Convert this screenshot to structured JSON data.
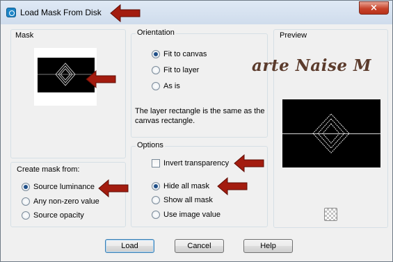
{
  "window": {
    "title": "Load Mask From Disk",
    "close_symbol": "×"
  },
  "mask": {
    "group_label": "Mask"
  },
  "create_from": {
    "group_label": "Create mask from:",
    "options": [
      {
        "label": "Source luminance",
        "checked": true
      },
      {
        "label": "Any non-zero value",
        "checked": false
      },
      {
        "label": "Source opacity",
        "checked": false
      }
    ]
  },
  "orientation": {
    "group_label": "Orientation",
    "options": [
      {
        "label": "Fit to canvas",
        "checked": true
      },
      {
        "label": "Fit to layer",
        "checked": false
      },
      {
        "label": "As is",
        "checked": false
      }
    ],
    "info": "The layer rectangle is the same as the canvas rectangle."
  },
  "options": {
    "group_label": "Options",
    "invert_label": "Invert transparency",
    "invert_checked": false,
    "radios": [
      {
        "label": "Hide all mask",
        "checked": true
      },
      {
        "label": "Show all mask",
        "checked": false
      },
      {
        "label": "Use image value",
        "checked": false
      }
    ]
  },
  "preview": {
    "group_label": "Preview"
  },
  "watermark": "arte Naise M",
  "buttons": {
    "load": "Load",
    "cancel": "Cancel",
    "help": "Help"
  },
  "colors": {
    "annotation_arrow": "#a31c0f",
    "accent": "#1f4f88",
    "watermark": "#5b3b2c"
  }
}
